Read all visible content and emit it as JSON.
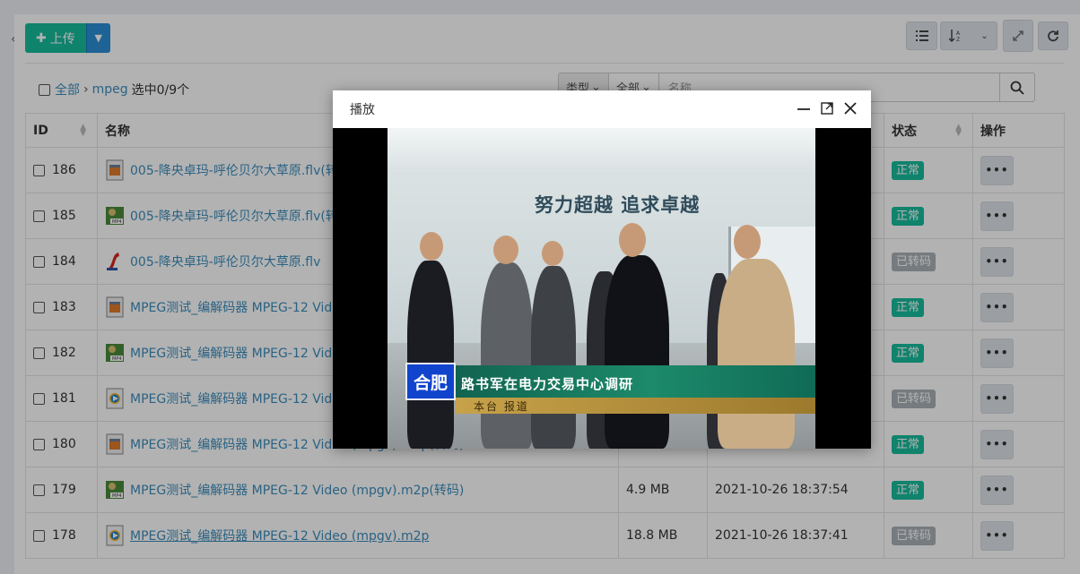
{
  "toolbar": {
    "upload_label": "上传",
    "upload_dropdown_icon": "caret-down-icon",
    "right_buttons": [
      "list-icon",
      "sort-alpha-icon",
      "expand-icon",
      "refresh-icon"
    ]
  },
  "breadcrumb": {
    "root": "全部",
    "folder": "mpeg",
    "selection": "选中0/9个"
  },
  "filter": {
    "type_label": "类型",
    "scope_label": "全部",
    "search_placeholder": "名称"
  },
  "table": {
    "columns": {
      "id": "ID",
      "name": "名称",
      "status": "状态",
      "actions": "操作"
    },
    "rows": [
      {
        "id": "186",
        "icon": "video-file-icon",
        "name": "005-降央卓玛-呼伦贝尔大草原.flv(转码)",
        "size": "",
        "time": "",
        "status": "正常",
        "status_type": "ok"
      },
      {
        "id": "185",
        "icon": "mp4-file-icon",
        "name": "005-降央卓玛-呼伦贝尔大草原.flv(转码)",
        "size": "",
        "time": "",
        "status": "正常",
        "status_type": "ok"
      },
      {
        "id": "184",
        "icon": "flash-file-icon",
        "name": "005-降央卓玛-呼伦贝尔大草原.flv",
        "size": "",
        "time": "",
        "status": "已转码",
        "status_type": "conv"
      },
      {
        "id": "183",
        "icon": "video-file-icon",
        "name": "MPEG测试_编解码器 MPEG-12 Video (mpgv).m2p(转码)",
        "size": "",
        "time": "",
        "status": "正常",
        "status_type": "ok"
      },
      {
        "id": "182",
        "icon": "mp4-file-icon",
        "name": "MPEG测试_编解码器 MPEG-12 Video (mpgv).m2p(转码)",
        "size": "",
        "time": "",
        "status": "正常",
        "status_type": "ok"
      },
      {
        "id": "181",
        "icon": "media-player-file-icon",
        "name": "MPEG测试_编解码器 MPEG-12 Video (mpgv).m2p",
        "size": "",
        "time": "",
        "status": "已转码",
        "status_type": "conv"
      },
      {
        "id": "180",
        "icon": "video-file-icon",
        "name": "MPEG测试_编解码器 MPEG-12 Video (mpgv).m2p(转码)",
        "size": "",
        "time": "",
        "status": "正常",
        "status_type": "ok"
      },
      {
        "id": "179",
        "icon": "mp4-file-icon",
        "name": "MPEG测试_编解码器 MPEG-12 Video (mpgv).m2p(转码)",
        "size": "4.9 MB",
        "time": "2021-10-26 18:37:54",
        "status": "正常",
        "status_type": "ok"
      },
      {
        "id": "178",
        "icon": "media-player-file-icon",
        "name": "MPEG测试_编解码器 MPEG-12 Video (mpgv).m2p",
        "size": "18.8 MB",
        "time": "2021-10-26 18:37:41",
        "status": "已转码",
        "status_type": "conv"
      }
    ],
    "action_label": "•••"
  },
  "modal": {
    "title": "播放",
    "video": {
      "wall_slogan": "努力超越  追求卓越",
      "caption_logo": "合肥",
      "caption_title": "路书军在电力交易中心调研",
      "caption_sub": "本台 报道"
    }
  },
  "colors": {
    "primary_green": "#18bc9c",
    "primary_blue": "#2c8fd6",
    "link": "#3c8dbc",
    "converted_gray": "#aab0b7"
  }
}
